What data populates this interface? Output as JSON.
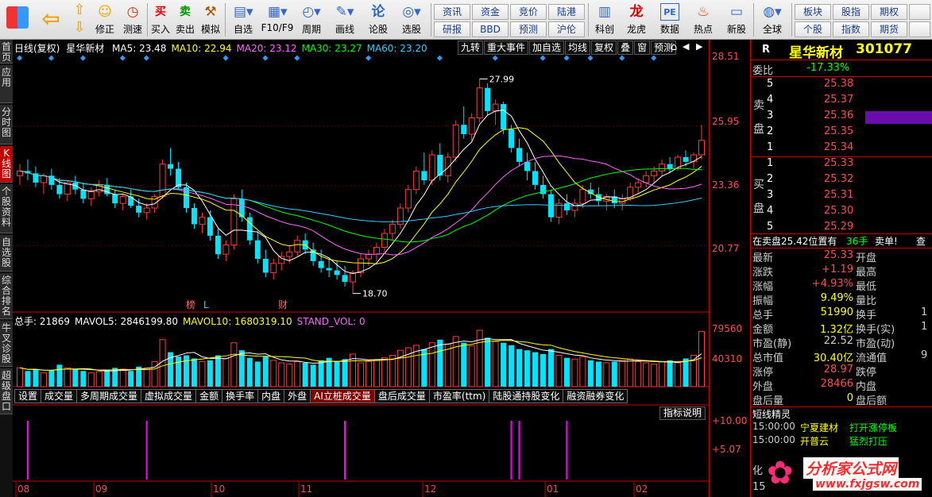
{
  "toolbar": {
    "big": [
      {
        "name": "back",
        "label": ""
      },
      {
        "name": "revise",
        "label": "修正"
      },
      {
        "name": "speedtest",
        "label": "测速"
      },
      {
        "name": "buy",
        "label": "买入",
        "icon": "买"
      },
      {
        "name": "sell",
        "label": "卖出",
        "icon": "卖"
      },
      {
        "name": "simulate",
        "label": "模拟"
      },
      {
        "name": "watchlist",
        "label": "自选"
      },
      {
        "name": "f10",
        "label": "F10/F9"
      },
      {
        "name": "period",
        "label": "周期"
      },
      {
        "name": "drawline",
        "label": "画线"
      },
      {
        "name": "forum",
        "label": "论股"
      },
      {
        "name": "pick",
        "label": "选股"
      }
    ],
    "small_top": [
      "资讯",
      "资金",
      "竞价",
      "陆港"
    ],
    "small_bottom": [
      "研报",
      "BBD",
      "预测",
      "沪伦"
    ],
    "big2": [
      {
        "name": "sci",
        "label": "科创"
      },
      {
        "name": "dragon",
        "label": "龙虎"
      },
      {
        "name": "data",
        "label": "数据",
        "icon": "PE"
      },
      {
        "name": "hotspot",
        "label": "热点"
      },
      {
        "name": "newstock",
        "label": "新股"
      },
      {
        "name": "global",
        "label": "全球"
      }
    ],
    "small2_top": [
      "板块",
      "股指",
      "期权"
    ],
    "small2_bottom": [
      "个股",
      "指数",
      "期货"
    ]
  },
  "left_tabs": [
    {
      "label": "首页",
      "active": false
    },
    {
      "label": "应用",
      "active": false
    },
    {
      "label": "分时图",
      "active": false
    },
    {
      "label": "K线图",
      "active": true
    },
    {
      "label": "个股资料",
      "active": false
    },
    {
      "label": "自选股",
      "active": false
    },
    {
      "label": "综合排名",
      "active": false
    },
    {
      "label": "牛叉诊股",
      "active": false
    },
    {
      "label": "超级盘口",
      "active": false
    }
  ],
  "main": {
    "ma_bar": {
      "prefix": "日线(复权)",
      "stock": "星华新材",
      "items": [
        {
          "text": "MA5: 23.48",
          "color": "#ffffff"
        },
        {
          "text": "MA10: 22.94",
          "color": "#ffff00"
        },
        {
          "text": "MA20: 23.12",
          "color": "#ff66ff"
        },
        {
          "text": "MA30: 23.27",
          "color": "#00ff00"
        },
        {
          "text": "MA60: 23.20",
          "color": "#33ccff"
        }
      ]
    },
    "chart_buttons": [
      "九转",
      "重大事件",
      "加自选",
      "均线",
      "复权",
      "叠",
      "窗",
      "预测"
    ],
    "price_ticks": [
      "28.51",
      "25.95",
      "23.36",
      "20.77"
    ],
    "high_label": "27.99",
    "low_label": "18.70",
    "markers": [
      "榜",
      "L",
      "财"
    ],
    "vol_bar": {
      "items": [
        {
          "text": "总手: 21869",
          "color": "#ffffff"
        },
        {
          "text": "MAVOL5: 2846199.80",
          "color": "#ffffff"
        },
        {
          "text": "MAVOL10: 1680319.10",
          "color": "#ffff00"
        },
        {
          "text": "STAND_VOL: 0",
          "color": "#ff66ff"
        }
      ]
    },
    "vol_ticks": [
      "79560",
      "40310"
    ],
    "indicator_tabs": [
      {
        "label": "设置",
        "active": false
      },
      {
        "label": "成交量",
        "active": false
      },
      {
        "label": "多周期成交量",
        "active": false
      },
      {
        "label": "虚拟成交量",
        "active": false
      },
      {
        "label": "金额",
        "active": false
      },
      {
        "label": "换手率",
        "active": false
      },
      {
        "label": "内盘",
        "active": false
      },
      {
        "label": "外盘",
        "active": false
      },
      {
        "label": "AI立桩成交量",
        "active": true
      },
      {
        "label": "盘后成交量",
        "active": false
      },
      {
        "label": "市盈率(ttm)",
        "active": false
      },
      {
        "label": "陆股通持股变化",
        "active": false
      },
      {
        "label": "融资融券变化",
        "active": false
      }
    ],
    "indicator_button": "指标说明",
    "ind_ticks": [
      "+10.00",
      "+5.07"
    ],
    "months": [
      "08",
      "09",
      "10",
      "11",
      "12",
      "01",
      "02"
    ]
  },
  "quote": {
    "r_label": "R",
    "name": "星华新材",
    "code": "301077",
    "ratio_label": "委比",
    "ratio_value": "-17.33%",
    "sell_label": "卖盘",
    "buy_label": "买盘",
    "sells": [
      {
        "lvl": "5",
        "price": "25.38",
        "vol": ""
      },
      {
        "lvl": "4",
        "price": "25.37",
        "vol": ""
      },
      {
        "lvl": "3",
        "price": "25.36",
        "vol": ""
      },
      {
        "lvl": "2",
        "price": "25.35",
        "vol": ""
      },
      {
        "lvl": "1",
        "price": "25.34",
        "vol": ""
      }
    ],
    "buys": [
      {
        "lvl": "1",
        "price": "25.33",
        "vol": ""
      },
      {
        "lvl": "2",
        "price": "25.32",
        "vol": ""
      },
      {
        "lvl": "3",
        "price": "25.31",
        "vol": ""
      },
      {
        "lvl": "4",
        "price": "25.30",
        "vol": ""
      },
      {
        "lvl": "5",
        "price": "25.29",
        "vol": ""
      }
    ],
    "info_line": {
      "a": "在卖盘25.42位置有",
      "b": "36手",
      "c": "卖单!",
      "d": "查"
    },
    "stats": [
      {
        "la": "最新",
        "va": "25.33",
        "ca": "#ff4d4d",
        "lb": "开盘",
        "vb": ""
      },
      {
        "la": "涨跌",
        "va": "+1.19",
        "ca": "#ff4d4d",
        "lb": "最高",
        "vb": ""
      },
      {
        "la": "涨幅",
        "va": "+4.93%",
        "ca": "#ff4d4d",
        "lb": "最低",
        "vb": ""
      },
      {
        "la": "振幅",
        "va": "9.49%",
        "ca": "#ffff00",
        "lb": "量比",
        "vb": ""
      },
      {
        "la": "总手",
        "va": "51990",
        "ca": "#ffff00",
        "lb": "换手",
        "vb": "1"
      },
      {
        "la": "金额",
        "va": "1.32亿",
        "ca": "#ffff00",
        "lb": "换手(实)",
        "vb": "1"
      },
      {
        "la": "市盈(静)",
        "va": "22.52",
        "ca": "#cccccc",
        "lb": "市盈(动)",
        "vb": ""
      },
      {
        "la": "总市值",
        "va": "30.40亿",
        "ca": "#ffff00",
        "lb": "流通值",
        "vb": "9"
      },
      {
        "la": "涨停",
        "va": "28.97",
        "ca": "#ff4d4d",
        "lb": "跌停",
        "vb": ""
      },
      {
        "la": "外盘",
        "va": "28466",
        "ca": "#ff4d4d",
        "lb": "内盘",
        "vb": ""
      },
      {
        "la": "盘后量",
        "va": "0",
        "ca": "#ffff00",
        "lb": "盘后额",
        "vb": ""
      }
    ],
    "shortline_title": "短线精灵",
    "shortline": [
      {
        "time": "15:00:00",
        "name": "宁夏建材",
        "event": "打开涨停板"
      },
      {
        "time": "15:00:00",
        "name": "开普云",
        "event": "猛烈打压"
      }
    ],
    "bottom_labels": [
      "化",
      "15"
    ],
    "watermark_title": "分析家公式网",
    "watermark_url": "www.fxjgsw.com"
  },
  "chart_data": {
    "type": "candlestick",
    "ylim": [
      18.0,
      29.0
    ],
    "candles": [
      [
        23.8,
        24.3,
        23.4,
        24.0
      ],
      [
        24.0,
        24.5,
        23.6,
        23.9
      ],
      [
        23.9,
        24.2,
        23.3,
        23.5
      ],
      [
        23.5,
        23.9,
        23.0,
        23.8
      ],
      [
        23.8,
        24.1,
        23.2,
        23.4
      ],
      [
        23.4,
        23.7,
        22.8,
        23.0
      ],
      [
        23.0,
        23.6,
        22.7,
        23.5
      ],
      [
        23.5,
        23.8,
        23.0,
        23.2
      ],
      [
        23.2,
        23.5,
        22.6,
        22.8
      ],
      [
        22.8,
        23.3,
        22.5,
        23.1
      ],
      [
        23.1,
        23.6,
        22.9,
        23.4
      ],
      [
        23.4,
        23.7,
        22.9,
        23.0
      ],
      [
        23.0,
        23.2,
        22.4,
        22.6
      ],
      [
        22.6,
        23.0,
        22.3,
        22.9
      ],
      [
        22.9,
        23.2,
        22.4,
        22.5
      ],
      [
        22.5,
        22.8,
        22.0,
        22.2
      ],
      [
        22.2,
        22.6,
        21.9,
        22.4
      ],
      [
        22.4,
        23.0,
        22.2,
        22.9
      ],
      [
        22.9,
        24.5,
        22.8,
        24.3
      ],
      [
        24.3,
        25.0,
        23.8,
        24.1
      ],
      [
        24.1,
        24.4,
        23.2,
        23.3
      ],
      [
        23.3,
        23.5,
        22.2,
        22.4
      ],
      [
        22.4,
        22.6,
        21.5,
        21.7
      ],
      [
        21.7,
        22.2,
        21.3,
        22.0
      ],
      [
        22.0,
        22.3,
        21.0,
        21.2
      ],
      [
        21.2,
        21.5,
        20.2,
        20.4
      ],
      [
        20.4,
        21.0,
        20.1,
        20.8
      ],
      [
        20.8,
        23.0,
        20.6,
        22.8
      ],
      [
        22.8,
        23.2,
        21.8,
        22.0
      ],
      [
        22.0,
        22.2,
        20.8,
        21.0
      ],
      [
        21.0,
        21.4,
        20.0,
        20.2
      ],
      [
        20.2,
        20.6,
        19.4,
        19.6
      ],
      [
        19.6,
        20.2,
        19.3,
        20.0
      ],
      [
        20.0,
        20.5,
        19.7,
        20.3
      ],
      [
        20.3,
        20.8,
        20.0,
        20.5
      ],
      [
        20.5,
        21.2,
        20.3,
        21.0
      ],
      [
        21.0,
        21.3,
        20.4,
        20.6
      ],
      [
        20.6,
        20.9,
        19.9,
        20.1
      ],
      [
        20.1,
        20.6,
        19.6,
        19.8
      ],
      [
        19.8,
        20.2,
        19.4,
        19.7
      ],
      [
        19.7,
        20.1,
        19.3,
        19.5
      ],
      [
        19.5,
        19.9,
        19.0,
        19.2
      ],
      [
        19.2,
        19.7,
        18.7,
        19.6
      ],
      [
        19.6,
        20.4,
        19.4,
        20.2
      ],
      [
        20.2,
        20.6,
        19.9,
        20.4
      ],
      [
        20.4,
        20.9,
        20.1,
        20.7
      ],
      [
        20.7,
        21.5,
        20.5,
        21.3
      ],
      [
        21.3,
        21.9,
        21.0,
        21.7
      ],
      [
        21.7,
        22.6,
        21.5,
        22.4
      ],
      [
        22.4,
        23.4,
        22.2,
        23.2
      ],
      [
        23.2,
        24.2,
        23.0,
        24.0
      ],
      [
        24.0,
        24.8,
        23.4,
        23.6
      ],
      [
        23.6,
        24.9,
        23.4,
        24.7
      ],
      [
        24.7,
        25.2,
        23.6,
        23.8
      ],
      [
        23.8,
        24.8,
        23.5,
        24.6
      ],
      [
        24.6,
        26.2,
        24.4,
        26.0
      ],
      [
        26.0,
        26.8,
        25.4,
        25.6
      ],
      [
        25.6,
        26.5,
        25.3,
        26.3
      ],
      [
        26.3,
        27.99,
        26.1,
        27.6
      ],
      [
        27.6,
        27.8,
        26.4,
        26.6
      ],
      [
        26.6,
        27.1,
        26.0,
        26.9
      ],
      [
        26.9,
        27.0,
        25.6,
        25.8
      ],
      [
        25.8,
        26.0,
        24.8,
        25.0
      ],
      [
        25.0,
        25.4,
        24.2,
        24.4
      ],
      [
        24.4,
        24.8,
        23.6,
        24.0
      ],
      [
        24.0,
        24.4,
        23.2,
        23.4
      ],
      [
        23.4,
        23.8,
        22.8,
        23.0
      ],
      [
        23.0,
        23.2,
        21.8,
        22.0
      ],
      [
        22.0,
        22.8,
        21.7,
        22.6
      ],
      [
        22.6,
        23.0,
        22.1,
        22.3
      ],
      [
        22.3,
        22.8,
        22.0,
        22.6
      ],
      [
        22.6,
        23.4,
        22.4,
        23.2
      ],
      [
        23.2,
        23.5,
        22.8,
        23.0
      ],
      [
        23.0,
        23.3,
        22.5,
        22.7
      ],
      [
        22.7,
        23.0,
        22.3,
        22.9
      ],
      [
        22.9,
        23.2,
        22.4,
        22.6
      ],
      [
        22.6,
        23.0,
        22.3,
        22.8
      ],
      [
        22.8,
        23.5,
        22.7,
        23.3
      ],
      [
        23.3,
        23.7,
        23.0,
        23.5
      ],
      [
        23.5,
        24.0,
        23.3,
        23.8
      ],
      [
        23.8,
        24.2,
        23.5,
        24.0
      ],
      [
        24.0,
        24.5,
        23.8,
        24.3
      ],
      [
        24.3,
        24.6,
        23.9,
        24.1
      ],
      [
        24.1,
        24.7,
        24.0,
        24.6
      ],
      [
        24.6,
        24.9,
        24.2,
        24.4
      ],
      [
        24.4,
        24.8,
        24.1,
        24.7
      ],
      [
        24.7,
        26.0,
        24.5,
        25.33
      ]
    ],
    "volume": [
      30,
      25,
      28,
      22,
      26,
      35,
      30,
      28,
      25,
      22,
      24,
      26,
      30,
      28,
      25,
      32,
      30,
      40,
      75,
      55,
      48,
      50,
      45,
      40,
      42,
      50,
      45,
      70,
      58,
      46,
      40,
      48,
      42,
      38,
      36,
      40,
      38,
      35,
      42,
      46,
      40,
      44,
      52,
      38,
      40,
      42,
      46,
      50,
      58,
      62,
      66,
      60,
      70,
      75,
      68,
      80,
      70,
      65,
      90,
      78,
      72,
      70,
      66,
      60,
      58,
      55,
      52,
      60,
      50,
      46,
      44,
      48,
      42,
      40,
      38,
      40,
      42,
      44,
      40,
      38,
      36,
      40,
      42,
      38,
      45,
      50,
      88
    ],
    "indicator_spikes": [
      1,
      16,
      41,
      62,
      63,
      69
    ]
  }
}
